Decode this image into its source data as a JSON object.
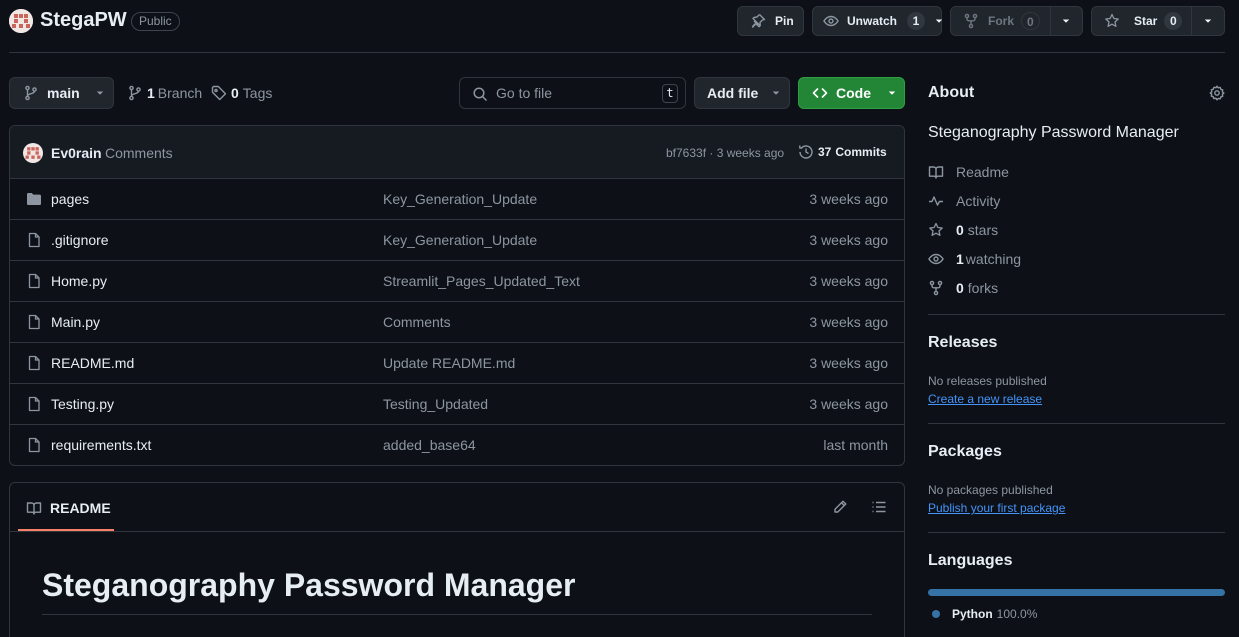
{
  "repo": {
    "name": "StegaPW",
    "visibility": "Public"
  },
  "actions": {
    "pin": "Pin",
    "unwatch": "Unwatch",
    "watch_count": "1",
    "fork": "Fork",
    "fork_count": "0",
    "star": "Star",
    "star_count": "0"
  },
  "toolbar": {
    "branch": "main",
    "branch_count": "1",
    "branch_label": "Branch",
    "tags_count": "0",
    "tags_label": "Tags",
    "search_placeholder": "Go to file",
    "search_shortcut": "t",
    "add_file": "Add file",
    "code": "Code"
  },
  "commit": {
    "author": "Ev0rain",
    "message": "Comments",
    "hash_time": "bf7633f · 3 weeks ago",
    "commits_count": "37",
    "commits_label": "Commits"
  },
  "files": [
    {
      "type": "folder",
      "name": "pages",
      "message": "Key_Generation_Update",
      "age": "3 weeks ago"
    },
    {
      "type": "file",
      "name": ".gitignore",
      "message": "Key_Generation_Update",
      "age": "3 weeks ago"
    },
    {
      "type": "file",
      "name": "Home.py",
      "message": "Streamlit_Pages_Updated_Text",
      "age": "3 weeks ago"
    },
    {
      "type": "file",
      "name": "Main.py",
      "message": "Comments",
      "age": "3 weeks ago"
    },
    {
      "type": "file",
      "name": "README.md",
      "message": "Update README.md",
      "age": "3 weeks ago"
    },
    {
      "type": "file",
      "name": "Testing.py",
      "message": "Testing_Updated",
      "age": "3 weeks ago"
    },
    {
      "type": "file",
      "name": "requirements.txt",
      "message": "added_base64",
      "age": "last month"
    }
  ],
  "readme": {
    "tab": "README",
    "heading": "Steganography Password Manager"
  },
  "about": {
    "title": "About",
    "description": "Steganography Password Manager",
    "readme": "Readme",
    "activity": "Activity",
    "stars_count": "0",
    "stars_label": "stars",
    "watching_count": "1",
    "watching_label": "watching",
    "forks_count": "0",
    "forks_label": "forks"
  },
  "releases": {
    "title": "Releases",
    "empty": "No releases published",
    "link": "Create a new release"
  },
  "packages": {
    "title": "Packages",
    "empty": "No packages published",
    "link": "Publish your first package"
  },
  "languages": {
    "title": "Languages",
    "items": [
      {
        "name": "Python",
        "percent": "100.0%",
        "fraction": 1.0,
        "color": "#3572A5"
      }
    ]
  },
  "colors": {
    "background": "#0d1117",
    "border": "#30363d",
    "green": "#238636",
    "link": "#4493f8",
    "accent_underline": "#f78166"
  }
}
